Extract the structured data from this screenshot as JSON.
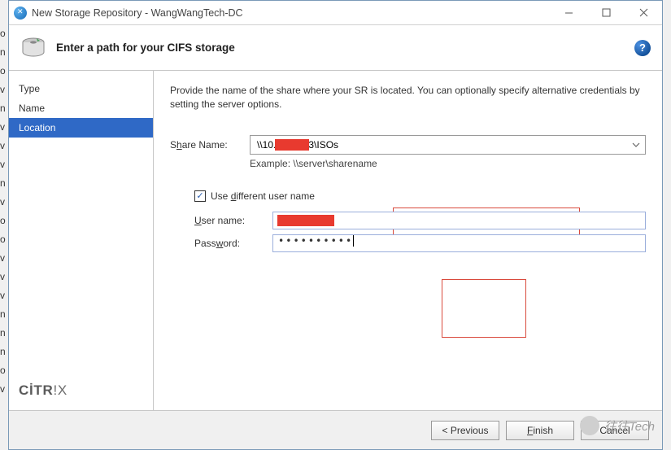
{
  "titlebar": {
    "title": "New Storage Repository - WangWangTech-DC"
  },
  "header": {
    "title": "Enter a path for your CIFS storage"
  },
  "sidebar": {
    "steps": [
      "Type",
      "Name",
      "Location"
    ],
    "active_index": 2,
    "brand_prefix": "CİTR",
    "brand_suffix": "!X"
  },
  "content": {
    "intro": "Provide the name of the share where your SR is located. You can optionally specify alternative credentials by setting the server options.",
    "share_label_pre": "S",
    "share_label_u": "h",
    "share_label_post": "are Name:",
    "share_value": "\\\\10.        253\\ISOs",
    "example_label": "Example: \\\\server\\sharename",
    "use_diff_pre": "Use ",
    "use_diff_u": "d",
    "use_diff_post": "ifferent user name",
    "use_diff_checked": true,
    "user_label_u": "U",
    "user_label_post": "ser name:",
    "user_value": " ",
    "pwd_label_pre": "Pass",
    "pwd_label_u": "w",
    "pwd_label_post": "ord:",
    "pwd_value": "••••••••••"
  },
  "footer": {
    "previous": "< Previous",
    "finish_u": "F",
    "finish_post": "inish",
    "cancel": "Cancel"
  },
  "watermark": "往往Tech"
}
